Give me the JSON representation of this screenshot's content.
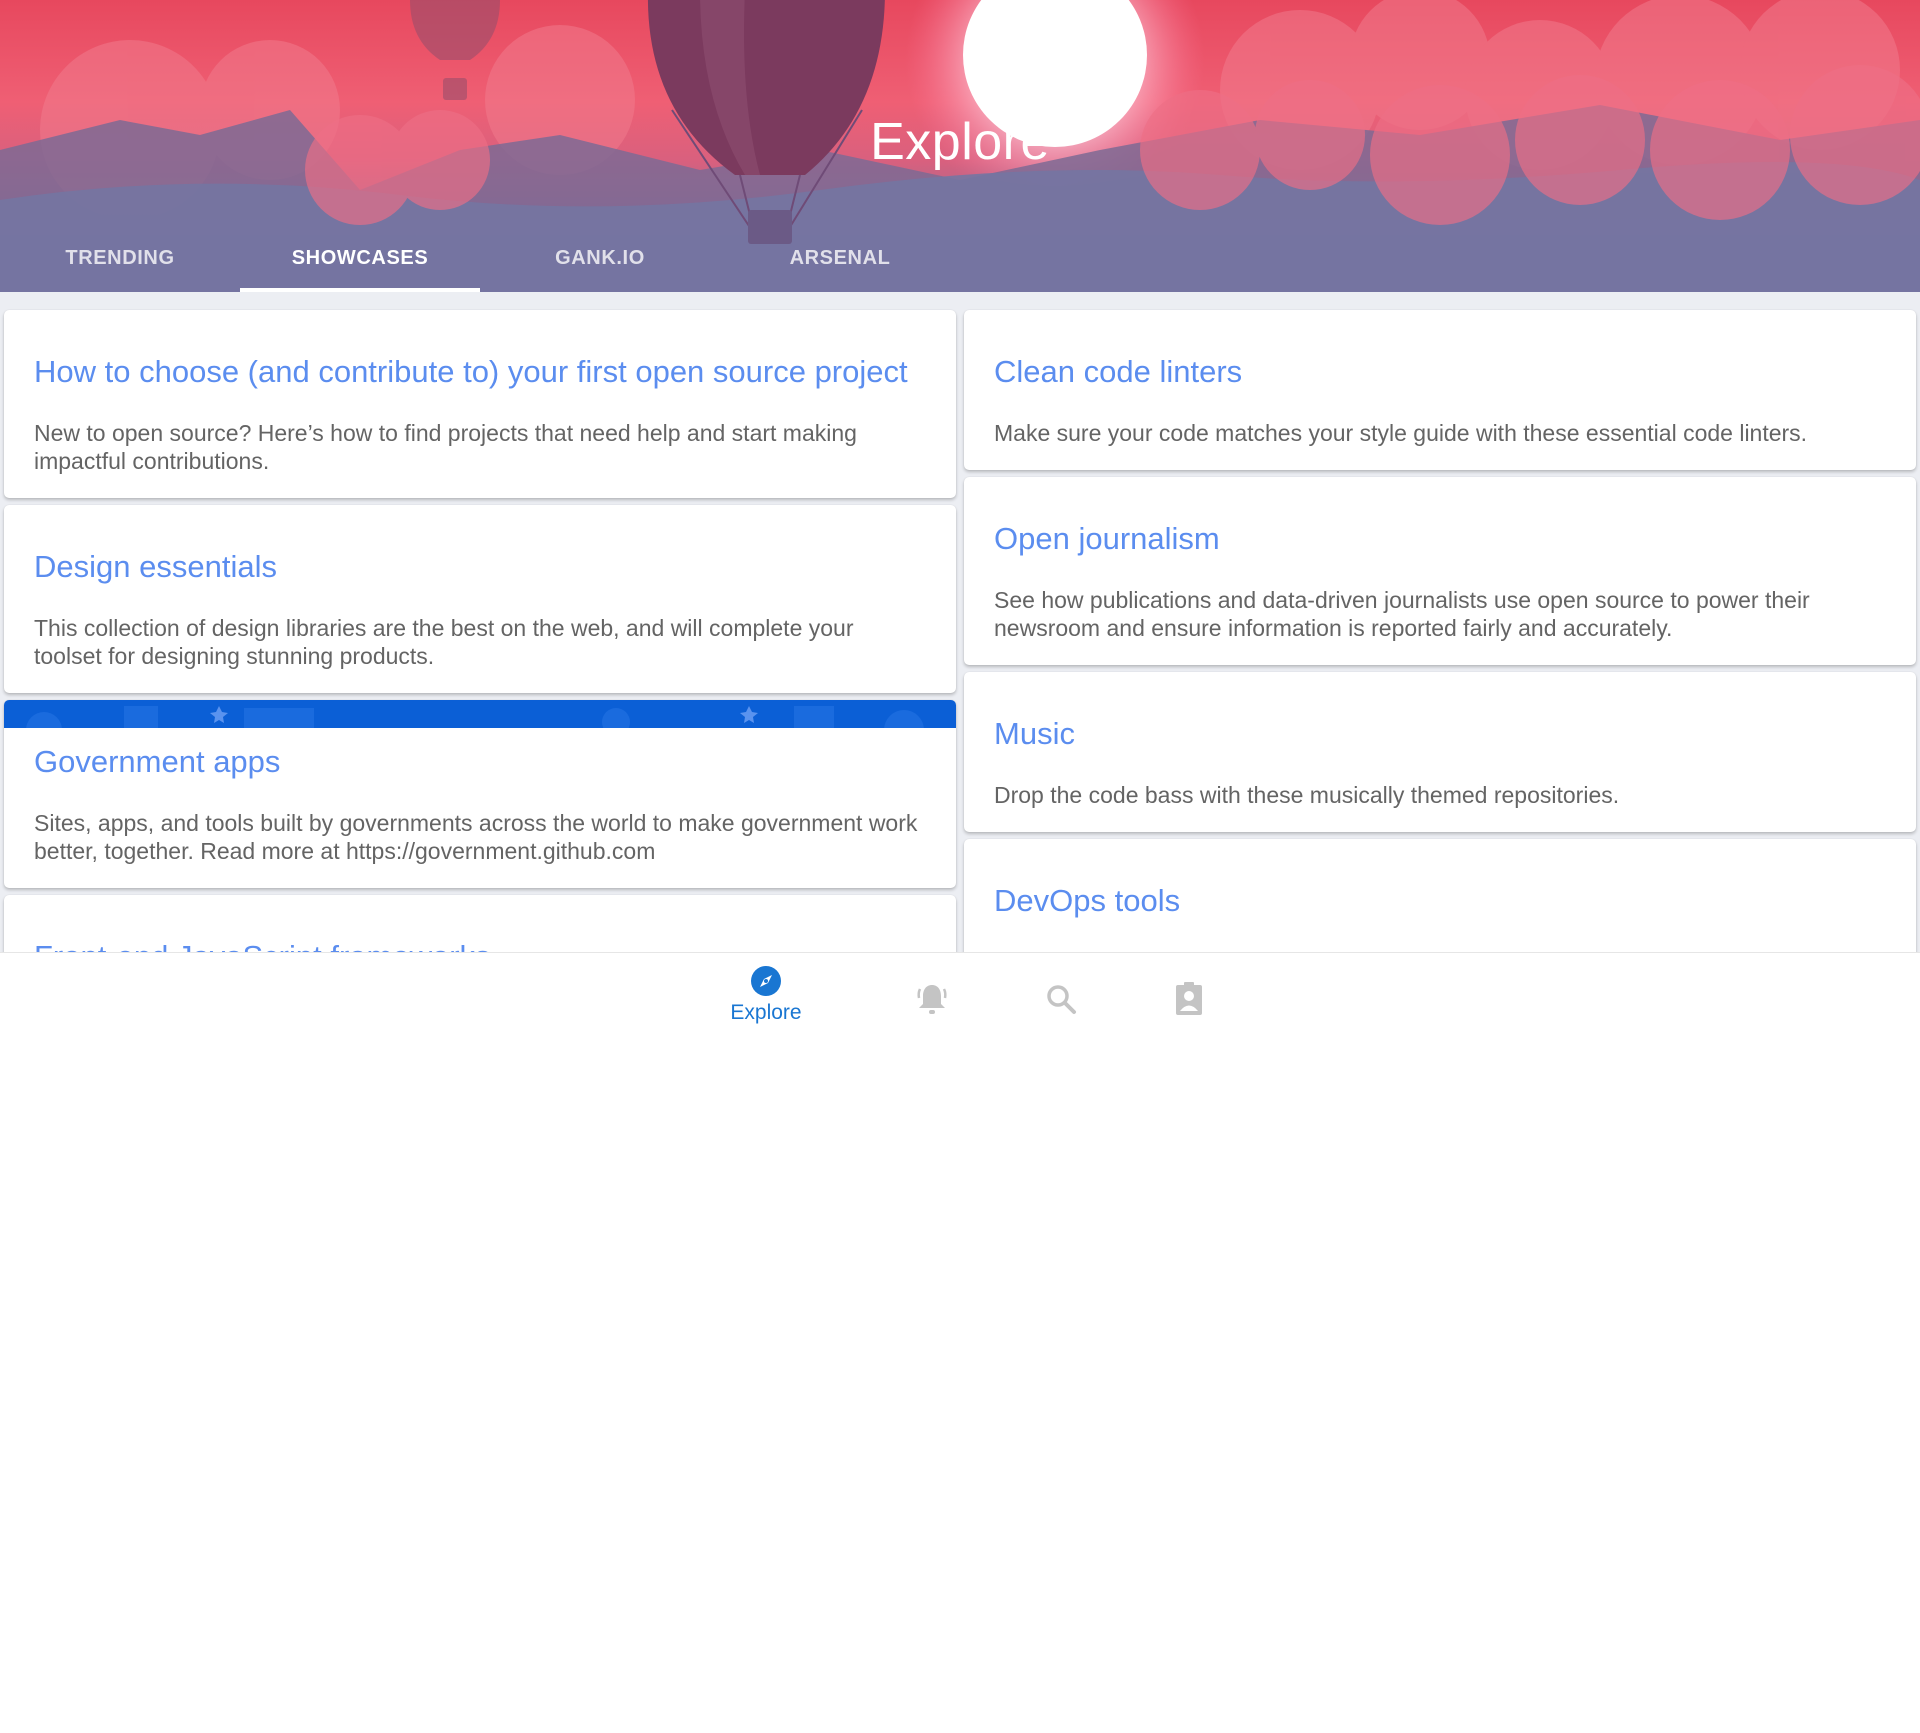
{
  "header": {
    "title": "Explore",
    "tabs": [
      {
        "label": "TRENDING",
        "active": false
      },
      {
        "label": "SHOWCASES",
        "active": true
      },
      {
        "label": "GANK.IO",
        "active": false
      },
      {
        "label": "ARSENAL",
        "active": false
      }
    ]
  },
  "showcases": {
    "left": [
      {
        "title": "How to choose (and contribute to) your first open source project",
        "description": "New to open source? Here’s how to find projects that need help and start making impactful contributions."
      },
      {
        "title": "Design essentials",
        "description": "This collection of design libraries are the best on the web, and will complete your toolset for designing stunning products."
      },
      {
        "title": "Government apps",
        "description": "Sites, apps, and tools built by governments across the world to make government work better, together. Read more at https://government.github.com"
      },
      {
        "title": "Front-end JavaScript frameworks",
        "description": ""
      }
    ],
    "right": [
      {
        "title": "Clean code linters",
        "description": "Make sure your code matches your style guide with these essential code linters."
      },
      {
        "title": "Open journalism",
        "description": "See how publications and data-driven journalists use open source to power their newsroom and ensure information is reported fairly and accurately."
      },
      {
        "title": "Music",
        "description": "Drop the code bass with these musically themed repositories."
      },
      {
        "title": "DevOps tools",
        "description": ""
      }
    ]
  },
  "bottom_nav": {
    "items": [
      {
        "label": "Explore",
        "icon": "compass-icon",
        "active": true
      },
      {
        "label": "",
        "icon": "notifications-icon",
        "active": false
      },
      {
        "label": "",
        "icon": "search-icon",
        "active": false
      },
      {
        "label": "",
        "icon": "profile-badge-icon",
        "active": false
      }
    ]
  },
  "colors": {
    "accent": "#1976d2",
    "card_title": "#5b8def",
    "card_text": "#646464",
    "inactive_icon": "#c4c4c4",
    "government_banner": "#0b5fd6"
  }
}
